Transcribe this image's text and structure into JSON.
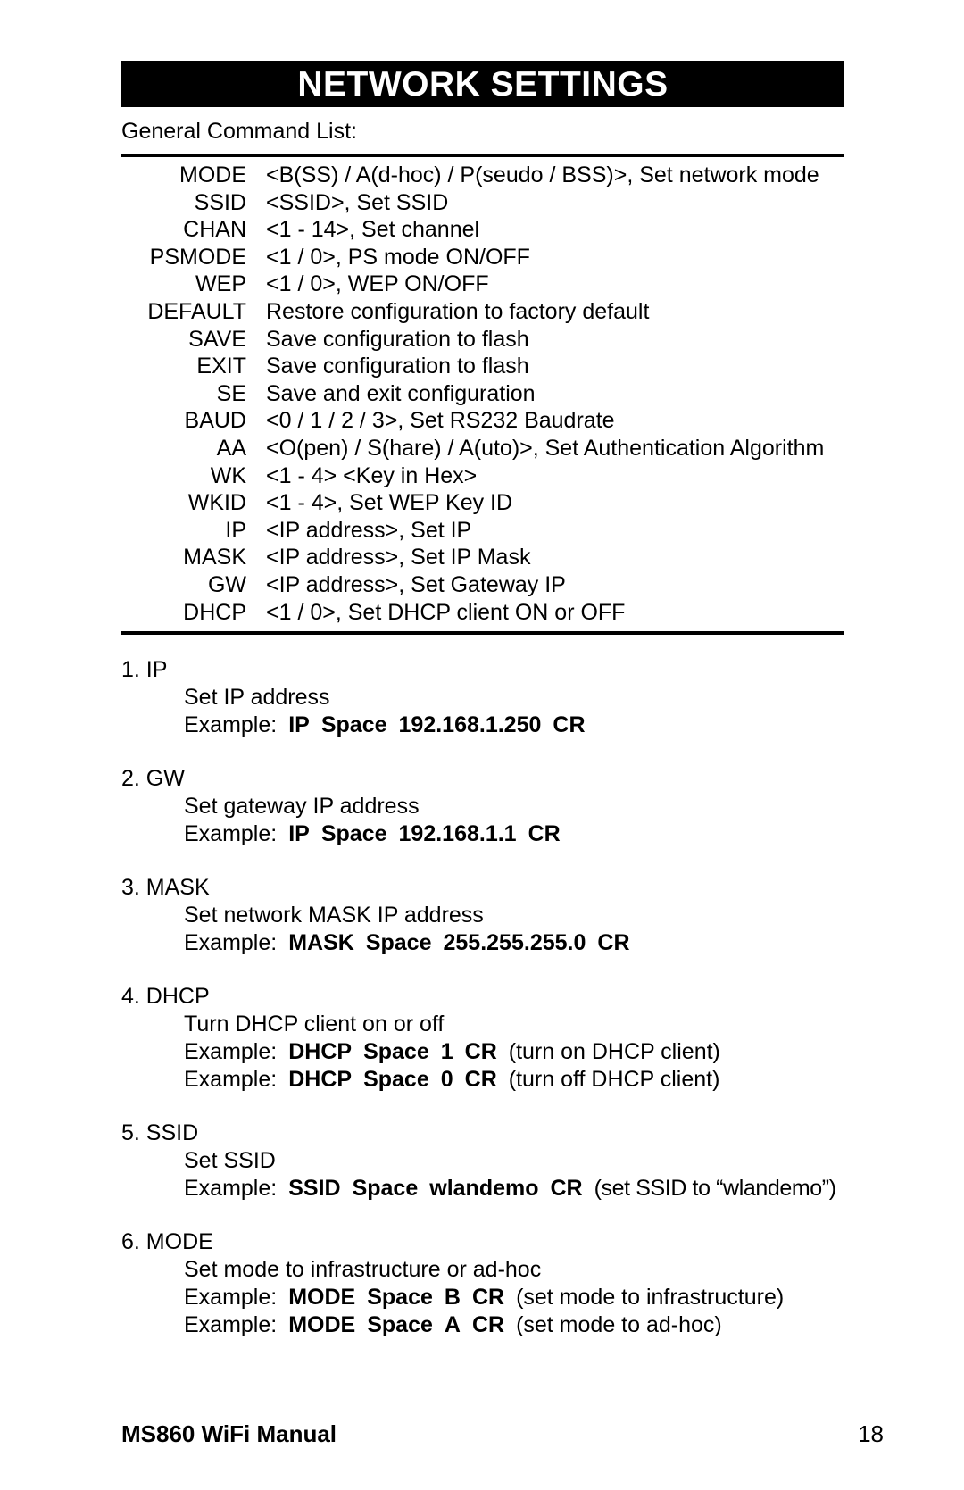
{
  "document": {
    "banner_title": "NETWORK SETTINGS",
    "intro_label": "General Command List:"
  },
  "command_table": {
    "rows": [
      {
        "name": "MODE",
        "desc": "<B(SS) / A(d-hoc) / P(seudo / BSS)>, Set network mode"
      },
      {
        "name": "SSID",
        "desc": "<SSID>, Set SSID"
      },
      {
        "name": "CHAN",
        "desc": "<1 - 14>, Set channel"
      },
      {
        "name": "PSMODE",
        "desc": "<1 / 0>, PS mode ON/OFF"
      },
      {
        "name": "WEP",
        "desc": "<1 / 0>, WEP ON/OFF"
      },
      {
        "name": "DEFAULT",
        "desc": "Restore configuration to factory default"
      },
      {
        "name": "SAVE",
        "desc": "Save configuration to flash"
      },
      {
        "name": "EXIT",
        "desc": "Save configuration to flash"
      },
      {
        "name": "SE",
        "desc": "Save and exit configuration"
      },
      {
        "name": "BAUD",
        "desc": "<0 / 1 / 2 / 3>, Set RS232 Baudrate"
      },
      {
        "name": "AA",
        "desc": "<O(pen) / S(hare) / A(uto)>, Set Authentication Algorithm"
      },
      {
        "name": "WK",
        "desc": "<1 - 4> <Key in Hex>"
      },
      {
        "name": "WKID",
        "desc": "<1 - 4>, Set WEP Key ID"
      },
      {
        "name": "IP",
        "desc": "<IP address>, Set IP"
      },
      {
        "name": "MASK",
        "desc": "<IP address>, Set IP Mask"
      },
      {
        "name": "GW",
        "desc": "<IP address>, Set Gateway IP"
      },
      {
        "name": "DHCP",
        "desc": "<1 / 0>, Set DHCP client ON or OFF"
      }
    ]
  },
  "sections": [
    {
      "heading": "1. IP",
      "description": "Set IP address",
      "examples": [
        {
          "label": "Example:",
          "command": "IP",
          "space": "Space",
          "value": "192.168.1.250",
          "cr": "CR",
          "note": ""
        }
      ]
    },
    {
      "heading": "2. GW",
      "description": "Set gateway IP address",
      "examples": [
        {
          "label": "Example:",
          "command": "IP",
          "space": "Space",
          "value": "192.168.1.1",
          "cr": "CR",
          "note": ""
        }
      ]
    },
    {
      "heading": "3. MASK",
      "description": "Set network MASK IP address",
      "examples": [
        {
          "label": "Example:",
          "command": "MASK",
          "space": "Space",
          "value": "255.255.255.0",
          "cr": "CR",
          "note": ""
        }
      ]
    },
    {
      "heading": "4. DHCP",
      "description": "Turn DHCP client on or off",
      "examples": [
        {
          "label": "Example:",
          "command": "DHCP",
          "space": "Space",
          "value": "1",
          "cr": "CR",
          "note": "(turn on DHCP client)"
        },
        {
          "label": "Example:",
          "command": "DHCP",
          "space": "Space",
          "value": "0",
          "cr": "CR",
          "note": "(turn off DHCP client)"
        }
      ]
    },
    {
      "heading": "5. SSID",
      "description": "Set SSID",
      "examples": [
        {
          "label": "Example:",
          "command": "SSID",
          "space": "Space",
          "value": "wlandemo",
          "cr": "CR",
          "note": "(set SSID to “wlandemo”)"
        }
      ]
    },
    {
      "heading": "6. MODE",
      "description": "Set mode to infrastructure or ad-hoc",
      "examples": [
        {
          "label": "Example:",
          "command": "MODE",
          "space": "Space",
          "value": "B",
          "cr": "CR",
          "note": "(set mode to infrastructure)"
        },
        {
          "label": "Example:",
          "command": "MODE",
          "space": "Space",
          "value": "A",
          "cr": "CR",
          "note": "(set mode to ad-hoc)"
        }
      ]
    }
  ],
  "footer": {
    "manual_title": "MS860 WiFi Manual",
    "page_number": "18"
  }
}
